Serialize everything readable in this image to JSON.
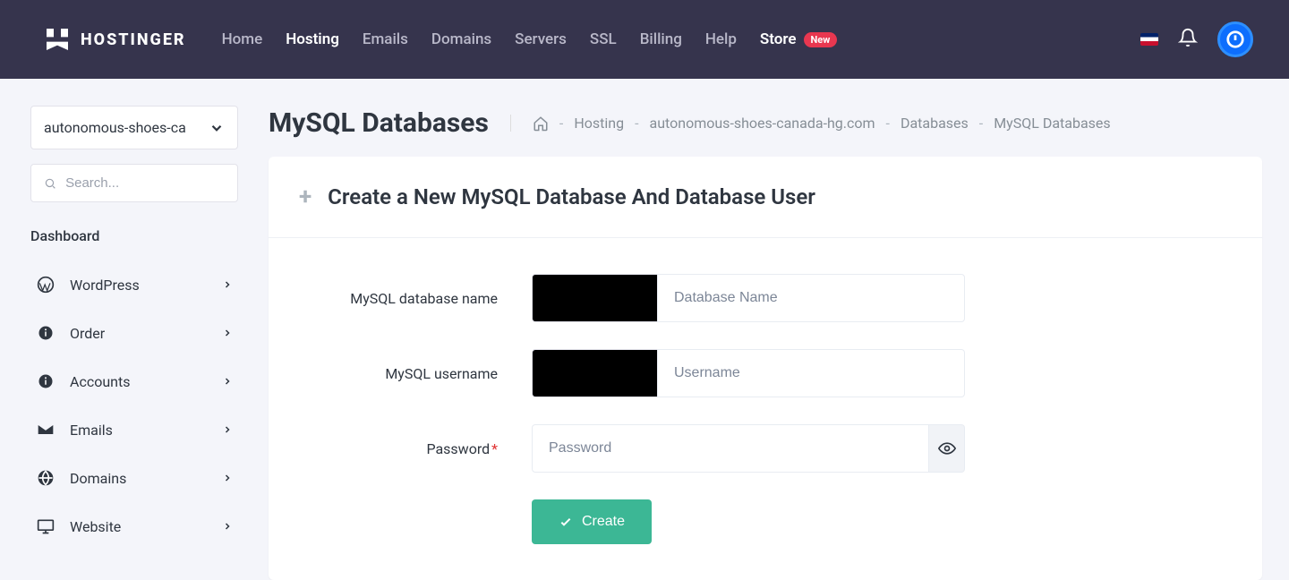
{
  "brand": "HOSTINGER",
  "nav": {
    "home": "Home",
    "hosting": "Hosting",
    "emails": "Emails",
    "domains": "Domains",
    "servers": "Servers",
    "ssl": "SSL",
    "billing": "Billing",
    "help": "Help",
    "store": "Store",
    "store_badge": "New"
  },
  "sidebar": {
    "site_selector": "autonomous-shoes-ca",
    "search_placeholder": "Search...",
    "dashboard_heading": "Dashboard",
    "items": {
      "wordpress": "WordPress",
      "order": "Order",
      "accounts": "Accounts",
      "emails": "Emails",
      "domains": "Domains",
      "website": "Website"
    }
  },
  "page": {
    "title": "MySQL Databases",
    "breadcrumb": {
      "hosting": "Hosting",
      "domain": "autonomous-shoes-canada-hg.com",
      "databases": "Databases",
      "current": "MySQL Databases"
    }
  },
  "form": {
    "heading": "Create a New MySQL Database And Database User",
    "db_name_label": "MySQL database name",
    "db_name_placeholder": "Database Name",
    "username_label": "MySQL username",
    "username_placeholder": "Username",
    "password_label": "Password",
    "password_required": "*",
    "password_placeholder": "Password",
    "create_button": "Create"
  }
}
